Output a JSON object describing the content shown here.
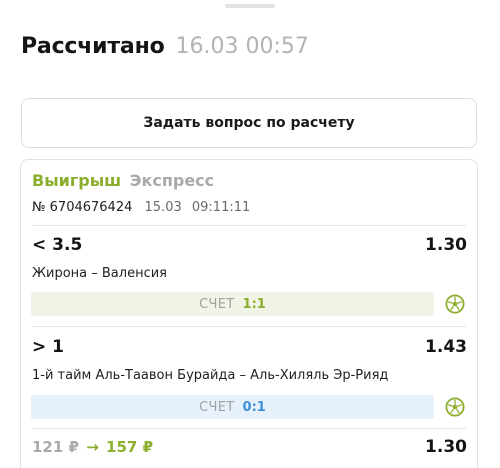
{
  "header": {
    "title": "Рассчитано",
    "datetime": "16.03 00:57"
  },
  "ask_button": {
    "label": "Задать вопрос по расчету"
  },
  "bet": {
    "result": "Выигрыш",
    "type": "Экспресс",
    "ticket_number": "№ 6704676424",
    "date": "15.03",
    "time": "09:11:11",
    "selections": [
      {
        "market": "< 3.5",
        "odds": "1.30",
        "event": "Жирона – Валенсия",
        "score_label": "СЧЕТ",
        "score": "1:1",
        "sport_icon": "football-icon",
        "score_color": "#8bae2d"
      },
      {
        "market": "> 1",
        "odds": "1.43",
        "event": "1-й тайм Аль-Таавон Бурайда – Аль-Хиляль Эр-Рияд",
        "score_label": "СЧЕТ",
        "score": "0:1",
        "sport_icon": "football-icon",
        "score_color": "#3b90d8"
      }
    ],
    "stake": "121 ₽",
    "arrow": "→",
    "payout": "157 ₽",
    "total_odds": "1.30"
  },
  "colors": {
    "win_green": "#8bae2d",
    "muted_gray": "#a9a9a9",
    "live_blue": "#3b90d8"
  }
}
